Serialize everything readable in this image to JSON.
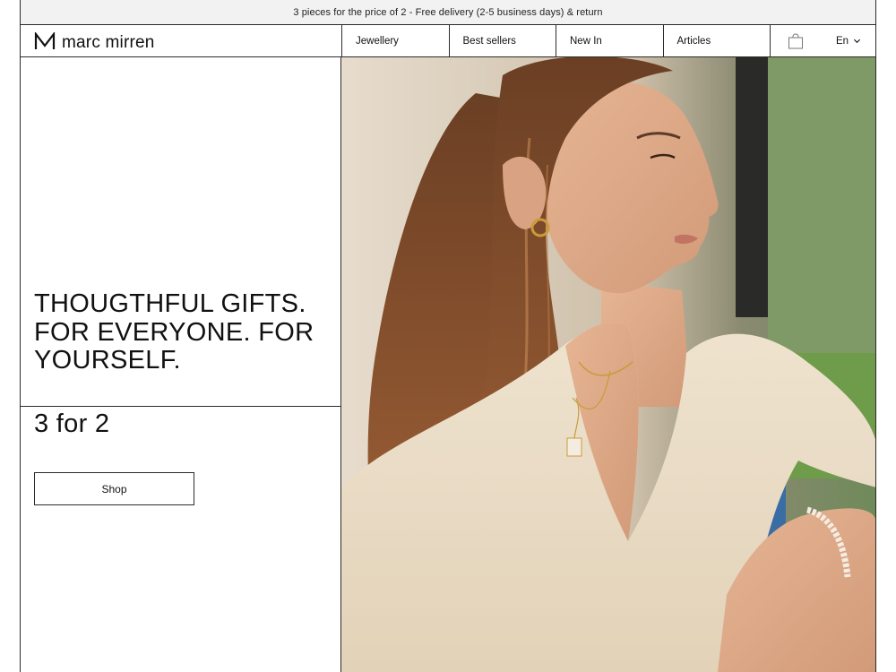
{
  "promo": {
    "text": "3 pieces for the price of 2 - Free delivery (2-5 business days) & return"
  },
  "header": {
    "logo_text": "marc mirren",
    "nav": [
      {
        "label": "Jewellery"
      },
      {
        "label": "Best sellers"
      },
      {
        "label": "New In"
      },
      {
        "label": "Articles"
      }
    ],
    "cart_icon": "shopping-bag-icon",
    "language": "En"
  },
  "hero": {
    "headline": "THOUGTHFUL GIFTS. FOR EVERYONE. FOR YOURSELF.",
    "offer": "3 for 2",
    "cta_label": "Shop"
  },
  "colors": {
    "border": "#2b2b2b",
    "promo_bg": "#f2f2f2",
    "text": "#111111"
  }
}
